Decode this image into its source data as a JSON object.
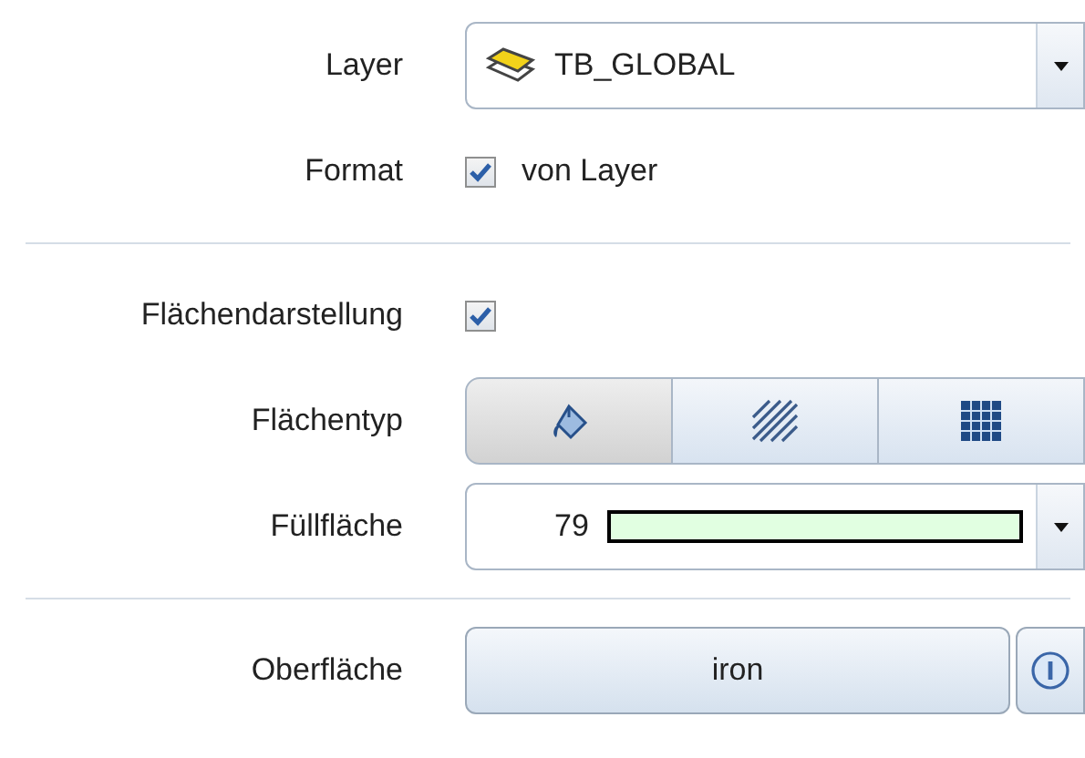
{
  "sections": [
    {
      "rows": [
        {
          "kind": "combo",
          "label": "Layer",
          "value": "TB_GLOBAL"
        },
        {
          "kind": "checkbox",
          "label": "Format",
          "text": "von Layer",
          "checked": true
        }
      ]
    },
    {
      "rows": [
        {
          "kind": "checkbox",
          "label": "Flächendarstellung",
          "checked": true
        },
        {
          "kind": "segmented",
          "label": "Flächentyp",
          "options": [
            {
              "kind": "fill",
              "selected": true
            },
            {
              "kind": "hatch",
              "selected": false
            },
            {
              "kind": "pattern",
              "selected": false
            }
          ]
        },
        {
          "kind": "color_combo",
          "label": "Füllfläche",
          "value": "79",
          "color": "#e1ffe1"
        }
      ]
    },
    {
      "rows": [
        {
          "kind": "button",
          "label": "Oberfläche",
          "value": "iron"
        }
      ]
    }
  ]
}
